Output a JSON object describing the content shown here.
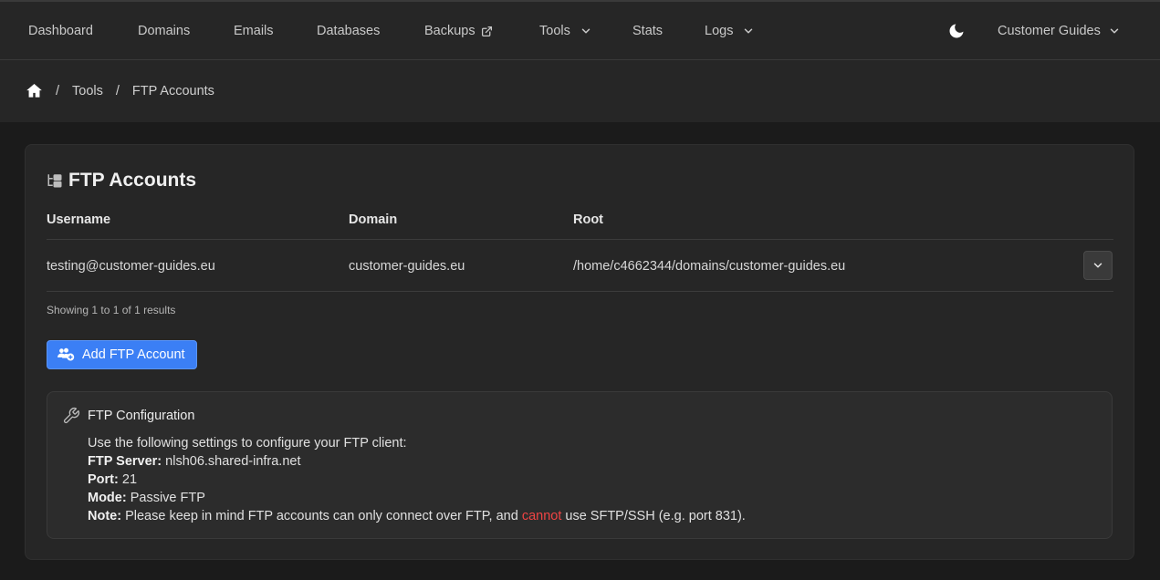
{
  "nav": {
    "items": [
      {
        "label": "Dashboard"
      },
      {
        "label": "Domains"
      },
      {
        "label": "Emails"
      },
      {
        "label": "Databases"
      },
      {
        "label": "Backups"
      },
      {
        "label": "Tools"
      },
      {
        "label": "Stats"
      },
      {
        "label": "Logs"
      }
    ],
    "account_label": "Customer Guides"
  },
  "breadcrumb": {
    "items": [
      "Tools",
      "FTP Accounts"
    ]
  },
  "card": {
    "title": "FTP Accounts",
    "columns": [
      "Username",
      "Domain",
      "Root"
    ],
    "rows": [
      {
        "username": "testing@customer-guides.eu",
        "domain": "customer-guides.eu",
        "root": "/home/c4662344/domains/customer-guides.eu"
      }
    ],
    "showing": "Showing 1 to 1 of 1 results",
    "add_button": "Add FTP Account"
  },
  "config": {
    "title": "FTP Configuration",
    "intro": "Use the following settings to configure your FTP client:",
    "server_label": "FTP Server:",
    "server_value": "nlsh06.shared-infra.net",
    "port_label": "Port:",
    "port_value": "21",
    "mode_label": "Mode:",
    "mode_value": "Passive FTP",
    "note_label": "Note:",
    "note_before": "Please keep in mind FTP accounts can only connect over FTP, and",
    "note_danger": "cannot",
    "note_after": "use SFTP/SSH (e.g. port 831)."
  },
  "colors": {
    "accent": "#3b7ff5",
    "danger": "#ef4444",
    "background": "#1b1b1b",
    "surface": "#262626"
  }
}
